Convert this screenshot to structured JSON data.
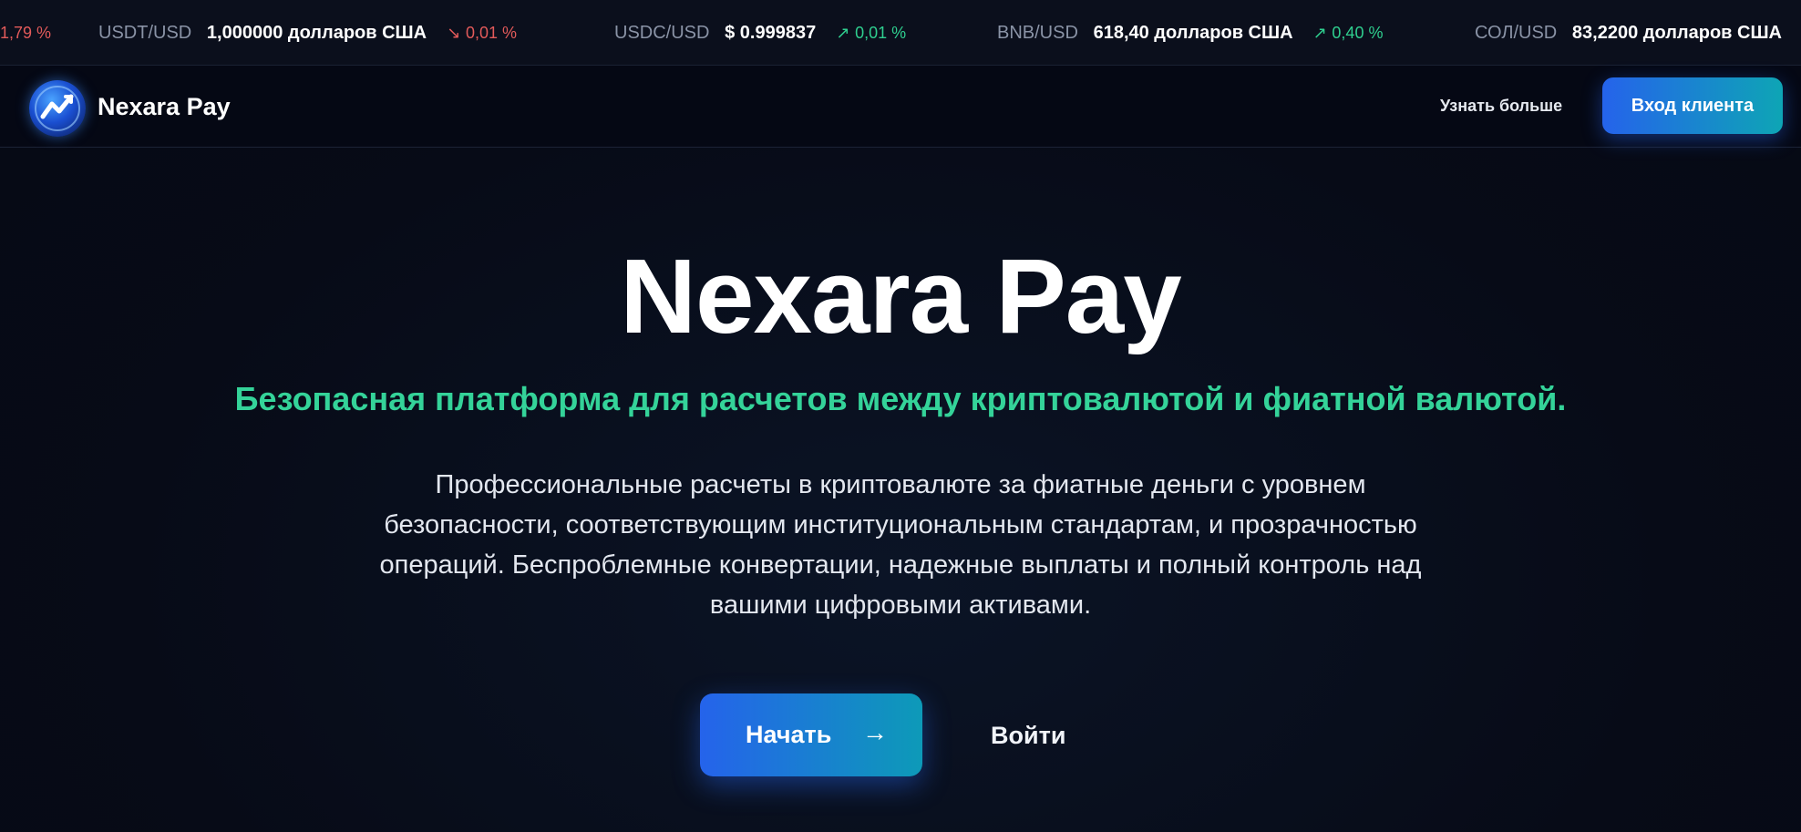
{
  "ticker": [
    {
      "symbol": "",
      "price": "",
      "change": "1,79 %",
      "direction": "down",
      "arrow": ""
    },
    {
      "symbol": "USDT/USD",
      "price": "1,000000 долларов США",
      "change": "0,01 %",
      "direction": "down",
      "arrow": "↘"
    },
    {
      "symbol": "USDC/USD",
      "price": "$ 0.999837",
      "change": "0,01 %",
      "direction": "up",
      "arrow": "↗"
    },
    {
      "symbol": "BNB/USD",
      "price": "618,40 долларов США",
      "change": "0,40 %",
      "direction": "up",
      "arrow": "↗"
    },
    {
      "symbol": "СОЛ/USD",
      "price": "83,2200 долларов США",
      "change": "",
      "direction": "",
      "arrow": ""
    }
  ],
  "header": {
    "brand": "Nexara Pay",
    "learn_more": "Узнать больше",
    "client_login": "Вход клиента"
  },
  "hero": {
    "title": "Nexara Pay",
    "subtitle": "Безопасная платформа для расчетов между криптовалютой и фиатной валютой.",
    "description": "Профессиональные расчеты в криптовалюте за фиатные деньги с уровнем безопасности, соответствующим институциональным стандартам, и прозрачностью операций. Беспроблемные конвертации, надежные выплаты и полный контроль над вашими цифровыми активами.",
    "start_label": "Начать",
    "start_arrow": "→",
    "login_label": "Войти"
  },
  "colors": {
    "accent_start": "#2563eb",
    "accent_end": "#0ea5b5",
    "positive": "#2fcf8f",
    "negative": "#e25a5a",
    "subtitle": "#34d399"
  }
}
